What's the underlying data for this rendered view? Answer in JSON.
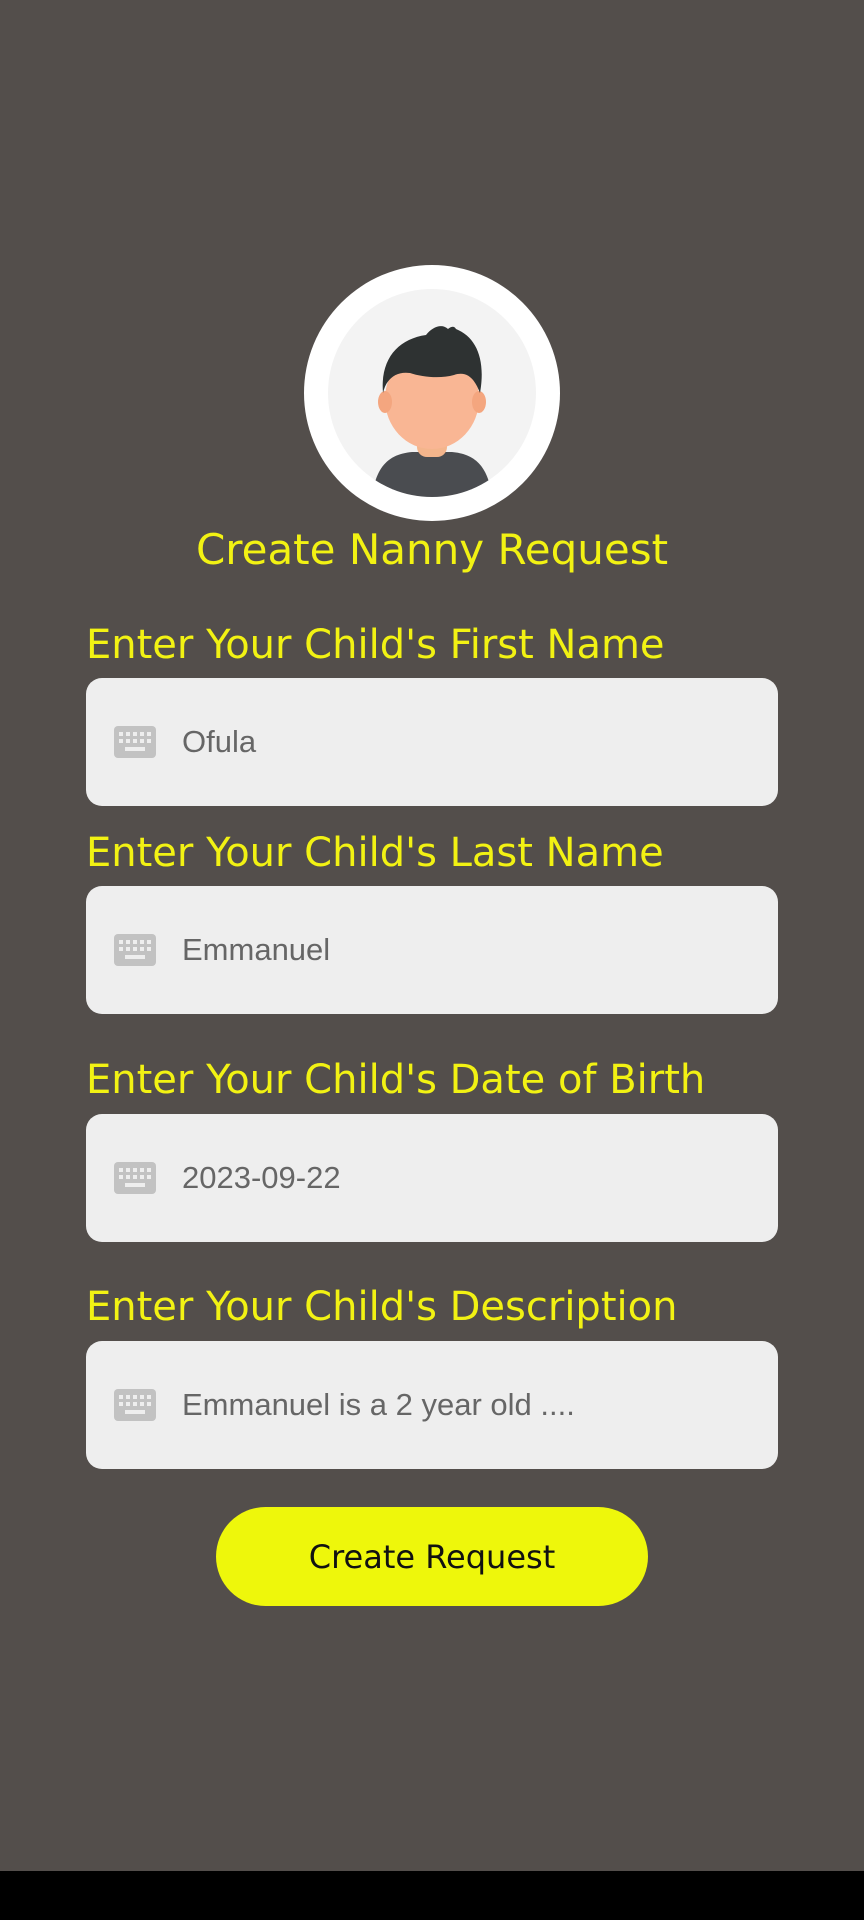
{
  "page": {
    "title": "Create Nanny Request"
  },
  "avatar": {
    "icon": "child-avatar-icon"
  },
  "form": {
    "fields": [
      {
        "label": "Enter Your Child's First Name",
        "value": "Ofula",
        "icon": "keyboard-icon"
      },
      {
        "label": "Enter Your Child's Last Name",
        "value": "Emmanuel",
        "icon": "keyboard-icon"
      },
      {
        "label": "Enter Your Child's Date of Birth",
        "value": "2023-09-22",
        "icon": "keyboard-icon"
      },
      {
        "label": "Enter Your Child's Description",
        "value": "Emmanuel is a 2 year old ....",
        "icon": "keyboard-icon"
      }
    ],
    "submit_label": "Create Request"
  },
  "colors": {
    "background": "#534e4b",
    "accent": "#f2f213",
    "button": "#eef70b",
    "field": "#eeeeee"
  }
}
